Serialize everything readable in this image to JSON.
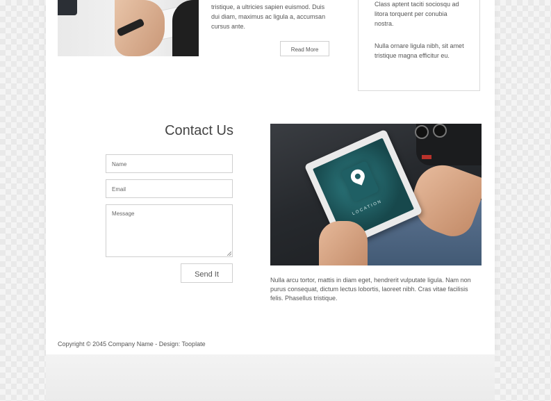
{
  "top": {
    "text": "tristique, a ultricies sapien euismod. Duis dui diam, maximus ac ligula a, accumsan cursus ante.",
    "read_more_label": "Read More",
    "side_paragraph_1": "Class aptent taciti sociosqu ad litora torquent per conubia nostra.",
    "side_paragraph_2": "Nulla ornare ligula nibh, sit amet tristique magna efficitur eu."
  },
  "contact": {
    "title": "Contact Us",
    "name_placeholder": "Name",
    "email_placeholder": "Email",
    "message_placeholder": "Message",
    "send_label": "Send It",
    "image_caption": "LOCATION",
    "description": "Nulla arcu tortor, mattis in diam eget, hendrerit vulputate ligula. Nam non purus consequat, dictum lectus lobortis, laoreet nibh. Cras vitae facilisis felis. Phasellus tristique."
  },
  "footer": {
    "copyright": "Copyright © 2045 Company Name - Design: Tooplate"
  },
  "colors": {
    "page_background": "#ffffff",
    "text": "#555555",
    "border": "#cfcfcf"
  }
}
